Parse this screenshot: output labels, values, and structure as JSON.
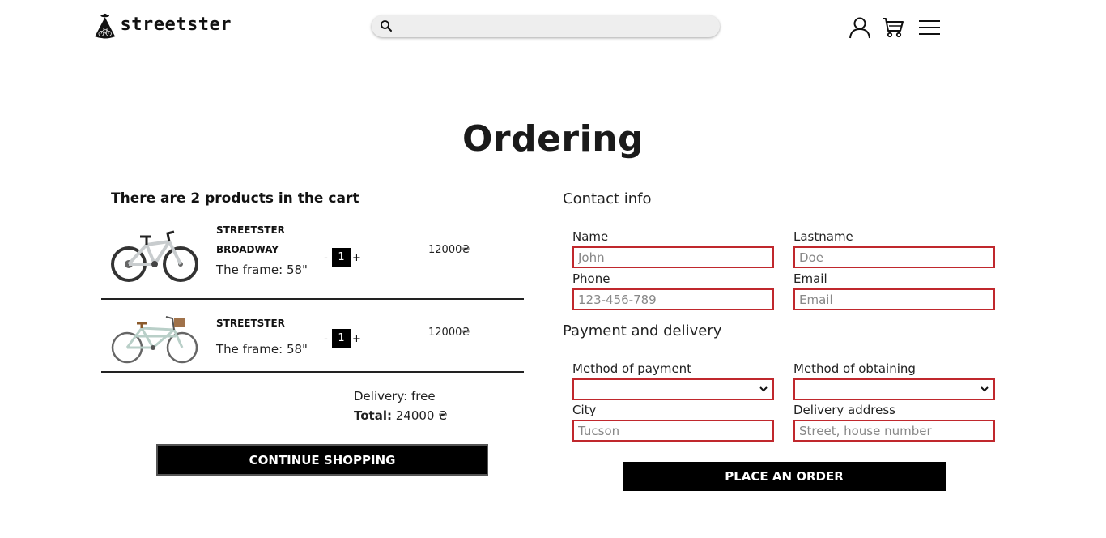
{
  "header": {
    "brand": "streetster",
    "search": {
      "placeholder": "",
      "value": ""
    },
    "icons": [
      "user-icon",
      "cart-icon",
      "menu-icon"
    ]
  },
  "page_title": "Ordering",
  "cart": {
    "heading": "There are 2 products in the cart",
    "items": [
      {
        "name": "STREETSTER BROADWAY",
        "frame": "The frame: 58\"",
        "qty": "1",
        "qty_minus": "-",
        "qty_plus": "+",
        "price": "12000₴"
      },
      {
        "name": "STREETSTER",
        "frame": "The frame: 58\"",
        "qty": "1",
        "qty_minus": "-",
        "qty_plus": "+",
        "price": "12000₴"
      }
    ],
    "delivery": "Delivery: free",
    "total_label": "Total:",
    "total_value": " 24000 ₴",
    "continue_label": "CONTINUE SHOPPING"
  },
  "form": {
    "contact_title": "Contact info",
    "name": {
      "label": "Name",
      "placeholder": "John"
    },
    "lastname": {
      "label": "Lastname",
      "placeholder": "Doe"
    },
    "phone": {
      "label": "Phone",
      "placeholder": "123-456-789"
    },
    "email": {
      "label": "Email",
      "placeholder": "Email"
    },
    "payment_title": "Payment and delivery",
    "payment_method": {
      "label": "Method of payment",
      "value": ""
    },
    "obtaining_method": {
      "label": "Method of obtaining",
      "value": ""
    },
    "city": {
      "label": "City",
      "placeholder": "Tucson"
    },
    "address": {
      "label": "Delivery address",
      "placeholder": "Street, house number"
    },
    "order_label": "PLACE AN ORDER"
  },
  "colors": {
    "invalid_border": "#c0282d",
    "button_bg": "#000000",
    "button_text": "#ffffff"
  }
}
